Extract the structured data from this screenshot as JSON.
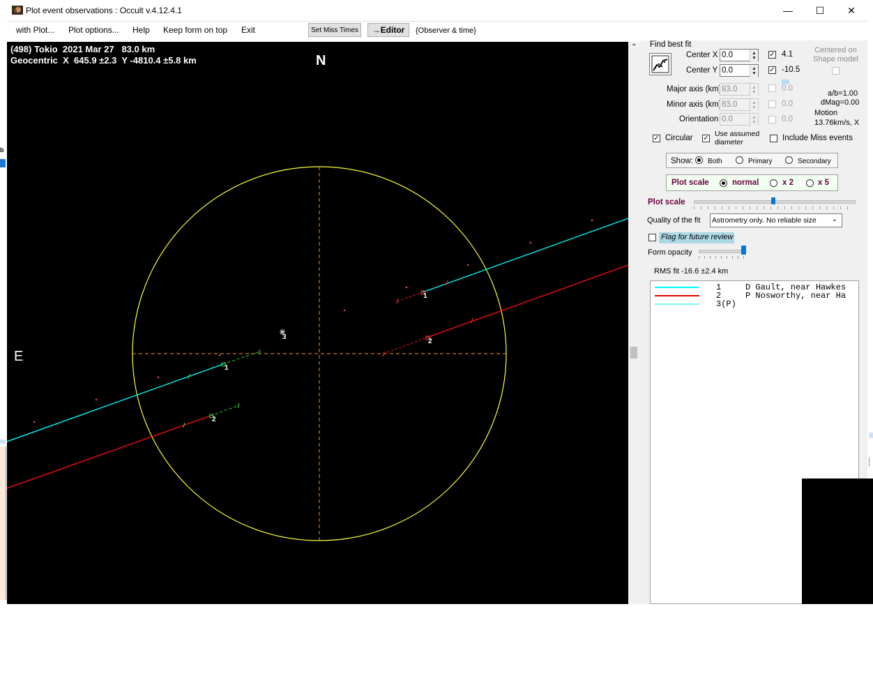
{
  "window": {
    "title": "Plot event observations : Occult v.4.12.4.1",
    "minimize_glyph": "—",
    "maximize_glyph": "☐",
    "close_glyph": "✕"
  },
  "menu": {
    "items": [
      "with Plot...",
      "Plot options...",
      "Help",
      "Keep form on top",
      "Exit"
    ],
    "set_miss_times": "Set Miss Times",
    "editor": "→Editor",
    "observer_time": "{Observer & time}"
  },
  "plot": {
    "header_line1": "(498) Tokio  2021 Mar 27   83.0 km",
    "header_line2": "Geocentric  X  645.9 ±2.3  Y -4810.4 ±5.8 km",
    "north_label": "N",
    "east_label": "E",
    "chord_labels": [
      "1",
      "2",
      "1",
      "2",
      "3"
    ],
    "colors": {
      "background": "#000000",
      "ellipse": "#ffff33",
      "axes": "#ff9900",
      "chord1": "#00ffff",
      "chord2": "#ff1010",
      "dashed": "#33cc33"
    }
  },
  "panel": {
    "find_best_fit": "Find best fit",
    "center_x_label": "Center X",
    "center_x_value": "0.0",
    "center_x_check_value": "4.1",
    "center_y_label": "Center Y",
    "center_y_value": "0.0",
    "center_y_check_value": "-10.5",
    "centered_on_shape": "Centered on\nShape model",
    "major_axis_label": "Major axis (km)",
    "major_axis_value": "83.0",
    "major_check_value": "0.0",
    "minor_axis_label": "Minor axis (km)",
    "minor_axis_value": "83.0",
    "minor_check_value": "0.0",
    "orientation_label": "Orientation",
    "orientation_value": "0.0",
    "orientation_check_value": "0.0",
    "ab_ratio": "a/b=1.00",
    "dmag": "dMag=0.00",
    "motion_label": "Motion",
    "motion_value": "13.76km/s, X",
    "circular_label": "Circular",
    "use_assumed_label": "Use assumed\ndiameter",
    "include_miss_label": "Include Miss events",
    "show_label": "Show:",
    "show_both": "Both",
    "show_primary": "Primary",
    "show_secondary": "Secondary",
    "plot_scale_label": "Plot scale",
    "scale_normal": "normal",
    "scale_x2": "x 2",
    "scale_x5": "x 5",
    "plot_scale_slider_label": "Plot scale",
    "quality_label": "Quality of the fit",
    "quality_value": "Astrometry only. No reliable size",
    "flag_review": "Flag for future review",
    "form_opacity_label": "Form opacity",
    "rms_fit": "RMS fit -16.6 ±2.4 km",
    "plot_scale_slider_fraction": 0.5,
    "form_opacity_fraction": 1.0
  },
  "legend": {
    "rows": [
      {
        "num": "1",
        "text": "D Gault, near Hawkes",
        "color": "#00ffff"
      },
      {
        "num": "2",
        "text": "P Nosworthy, near Ha",
        "color": "#e00000"
      },
      {
        "num": "3(P)",
        "text": "",
        "color": "#7ff5e6"
      }
    ]
  }
}
